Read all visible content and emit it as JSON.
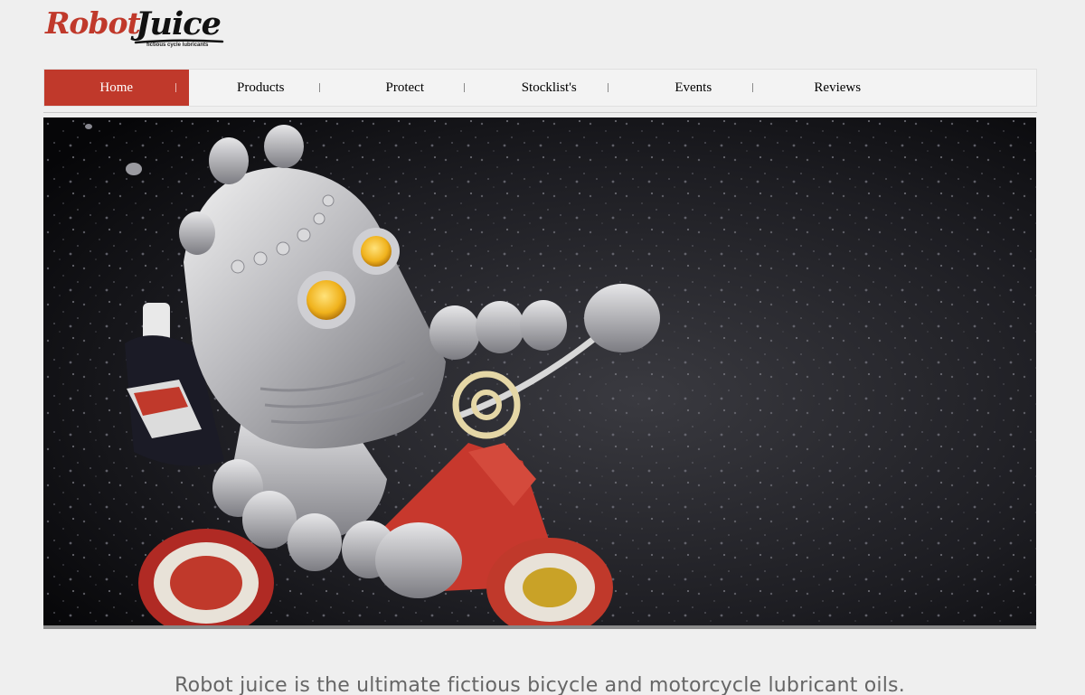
{
  "logo": {
    "word1": "Robot",
    "word2": "Juice",
    "tagline": "fictious cycle lubricants"
  },
  "nav": {
    "items": [
      {
        "label": "Home",
        "active": true
      },
      {
        "label": "Products",
        "active": false
      },
      {
        "label": "Protect",
        "active": false
      },
      {
        "label": "Stocklist's",
        "active": false
      },
      {
        "label": "Events",
        "active": false
      },
      {
        "label": "Reviews",
        "active": false
      }
    ]
  },
  "hero": {
    "image": "toy-robot-riding-tricycle-photo"
  },
  "content": {
    "tagline": "Robot juice is the ultimate fictious bicycle and motorcycle lubricant oils."
  },
  "colors": {
    "brand_red": "#c0392b",
    "background": "#efefef",
    "tagline_text": "#666666"
  }
}
